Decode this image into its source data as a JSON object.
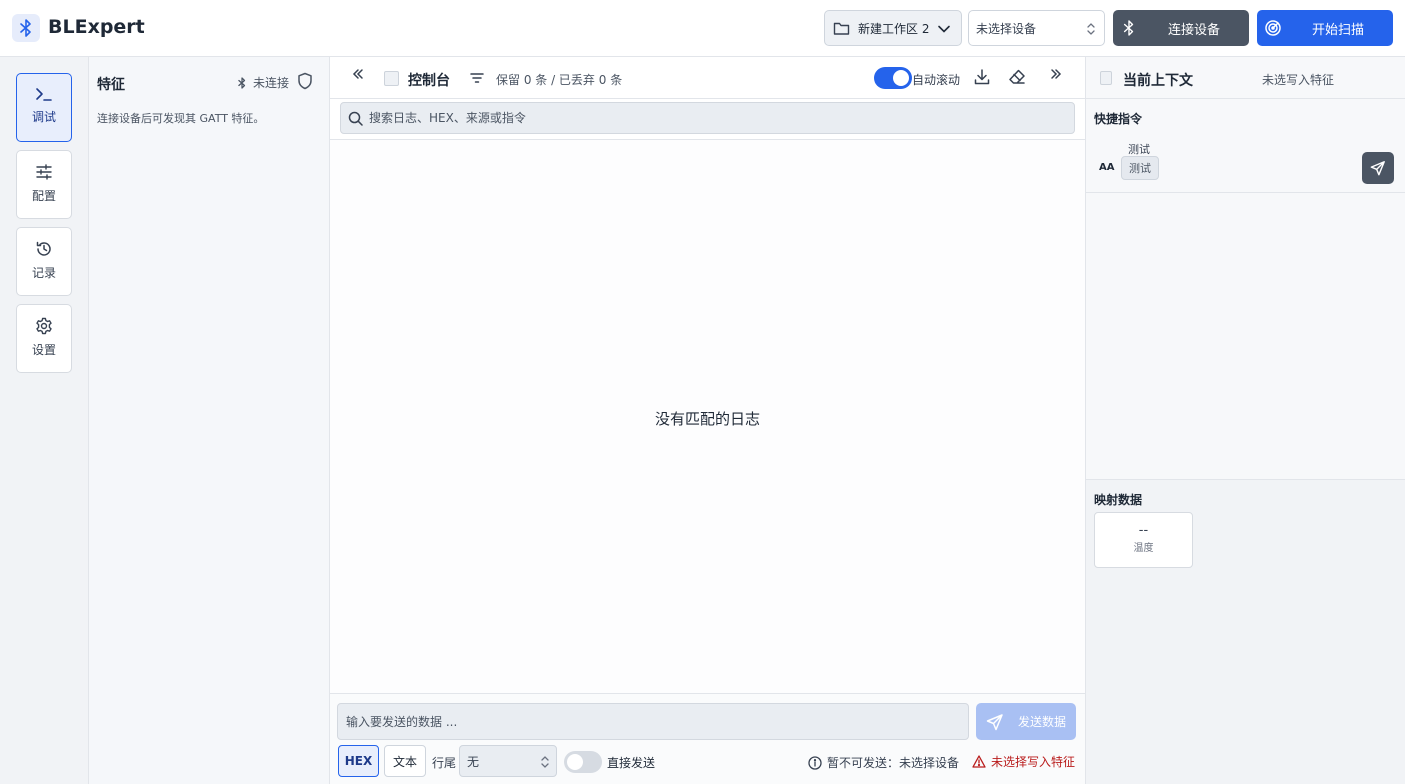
{
  "app": {
    "title": "BLExpert",
    "logo_icon": "bluetooth-icon"
  },
  "header": {
    "workspace": "新建工作区 2",
    "device_select": "未选择设备",
    "connect_label": "连接设备",
    "scan_label": "开始扫描"
  },
  "nav": {
    "items": [
      {
        "label": "调试",
        "icon": "terminal-icon",
        "active": true
      },
      {
        "label": "配置",
        "icon": "sliders-icon",
        "active": false
      },
      {
        "label": "记录",
        "icon": "history-icon",
        "active": false
      },
      {
        "label": "设置",
        "icon": "gear-icon",
        "active": false
      }
    ]
  },
  "features": {
    "title": "特征",
    "status": "未连接",
    "hint": "连接设备后可发现其 GATT 特征。"
  },
  "console": {
    "title": "控制台",
    "stats": "保留 0 条 / 已丢弃 0 条",
    "autoscroll_label": "自动滚动",
    "autoscroll_on": true,
    "search_placeholder": "搜索日志、HEX、来源或指令",
    "empty_text": "没有匹配的日志",
    "send_placeholder": "输入要发送的数据 ...",
    "send_label": "发送数据",
    "format_hex": "HEX",
    "format_text": "文本",
    "eol_label": "行尾",
    "eol_value": "无",
    "direct_label": "直接发送",
    "direct_on": false,
    "cant_send": "暂不可发送：未选择设备",
    "no_char": "未选择写入特征"
  },
  "context": {
    "title": "当前上下文",
    "status": "未选写入特征",
    "quick_title": "快捷指令",
    "quick_items": [
      {
        "badge": "AA",
        "name": "测试",
        "chip": "测试"
      }
    ],
    "mapped_title": "映射数据",
    "mapped_items": [
      {
        "value": "--",
        "label": "温度"
      }
    ]
  },
  "colors": {
    "accent": "#2563eb",
    "dark_button": "#4b5563",
    "error": "#b91c1c",
    "disabled_send": "#a9c0f3"
  }
}
